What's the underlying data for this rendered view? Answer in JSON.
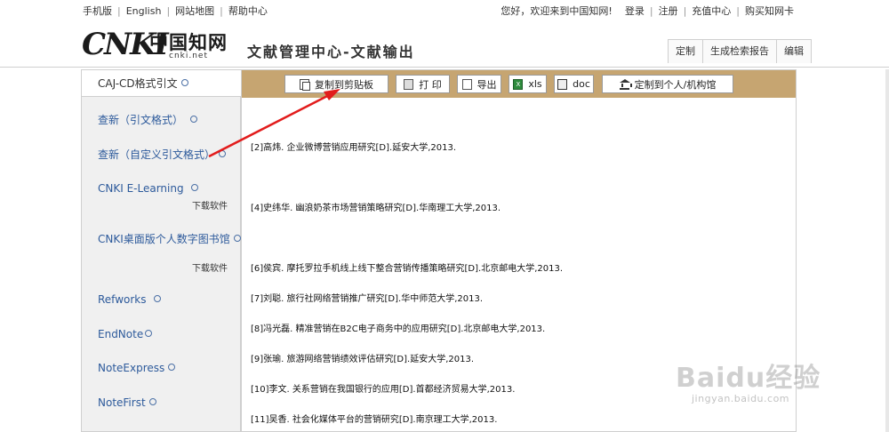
{
  "topbar": {
    "left_links": [
      "手机版",
      "English",
      "网站地图",
      "帮助中心"
    ],
    "welcome": "您好，欢迎来到中国知网!",
    "right_links": [
      "登录",
      "注册",
      "充值中心",
      "购买知网卡"
    ]
  },
  "header": {
    "logo_text": "CNKI",
    "logo_cn": "中国知网",
    "logo_domain": "cnki.net",
    "title": "文献管理中心-文献输出",
    "actions": [
      "定制",
      "生成检索报告",
      "编辑"
    ]
  },
  "sidebar": {
    "active_tab": "CAJ-CD格式引文",
    "items": [
      {
        "label": "查新（引文格式）"
      },
      {
        "label": "查新（自定义引文格式）"
      },
      {
        "label": "CNKI E-Learning",
        "download": "下载软件"
      },
      {
        "label": "CNKI桌面版个人数字图书馆",
        "download": "下载软件"
      },
      {
        "label": "Refworks"
      },
      {
        "label": "EndNote"
      },
      {
        "label": "NoteExpress"
      },
      {
        "label": "NoteFirst"
      }
    ]
  },
  "toolbar": {
    "copy": "复制到剪贴板",
    "print": "打 印",
    "export": "导出",
    "xls": "xls",
    "doc": "doc",
    "institution": "定制到个人/机构馆"
  },
  "references": [
    "[2]高炜. 企业微博营销应用研究[D].延安大学,2013.",
    "[4]史纬华. 幽浪奶茶市场营销策略研究[D].华南理工大学,2013.",
    "[6]侯宾. 摩托罗拉手机线上线下整合营销传播策略研究[D].北京邮电大学,2013.",
    "[7]刘聪. 旅行社网络营销推广研究[D].华中师范大学,2013.",
    "[8]冯光磊. 精准营销在B2C电子商务中的应用研究[D].北京邮电大学,2013.",
    "[9]张瑜. 旅游网络营销绩效评估研究[D].延安大学,2013.",
    "[10]李文. 关系营销在我国银行的应用[D].首都经济贸易大学,2013.",
    "[11]吴香. 社会化媒体平台的营销研究[D].南京理工大学,2013."
  ],
  "watermark": {
    "main": "Baidu经验",
    "sub": "jingyan.baidu.com"
  },
  "colors": {
    "toolbar_bg": "#c6a571",
    "sidebar_bg": "#f0f0f0",
    "link": "#2d5a9b",
    "annotation_arrow": "#e21c1c"
  }
}
